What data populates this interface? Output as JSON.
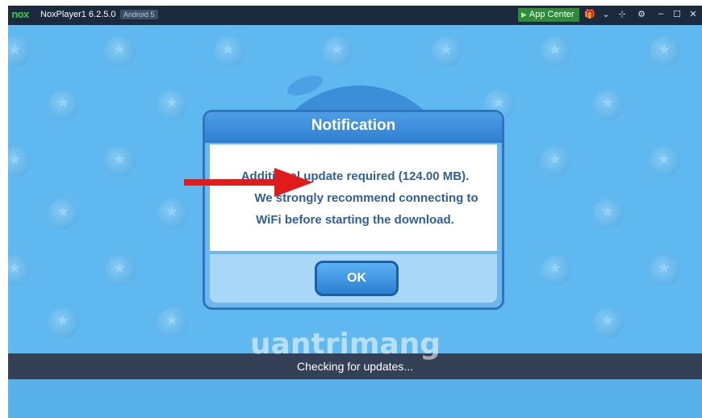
{
  "titlebar": {
    "logo": "nox",
    "app_name": "NoxPlayer1 6.2.5.0",
    "android_badge": "Android 5",
    "app_center_label": "App Center",
    "icons": [
      "gift-icon",
      "chevron-down-icon",
      "pin-icon",
      "gear-icon",
      "minimize-icon",
      "maximize-icon",
      "close-icon"
    ]
  },
  "dialog": {
    "title": "Notification",
    "message_lines": [
      "Additional update required (124.00 MB).",
      "We strongly recommend connecting to",
      "WiFi before starting the download."
    ],
    "ok_label": "OK"
  },
  "status_bar": {
    "text": "Checking for updates..."
  },
  "watermark": "uantrimang",
  "colors": {
    "titlebar_bg": "#1b2a3c",
    "app_center_bg": "#2e8d3a",
    "screen_bg": "#5fb8ef",
    "dialog_header": "#2e7fd0",
    "message_text": "#2f5f9e",
    "arrow": "#e01b1b",
    "status_bg": "#334055"
  }
}
